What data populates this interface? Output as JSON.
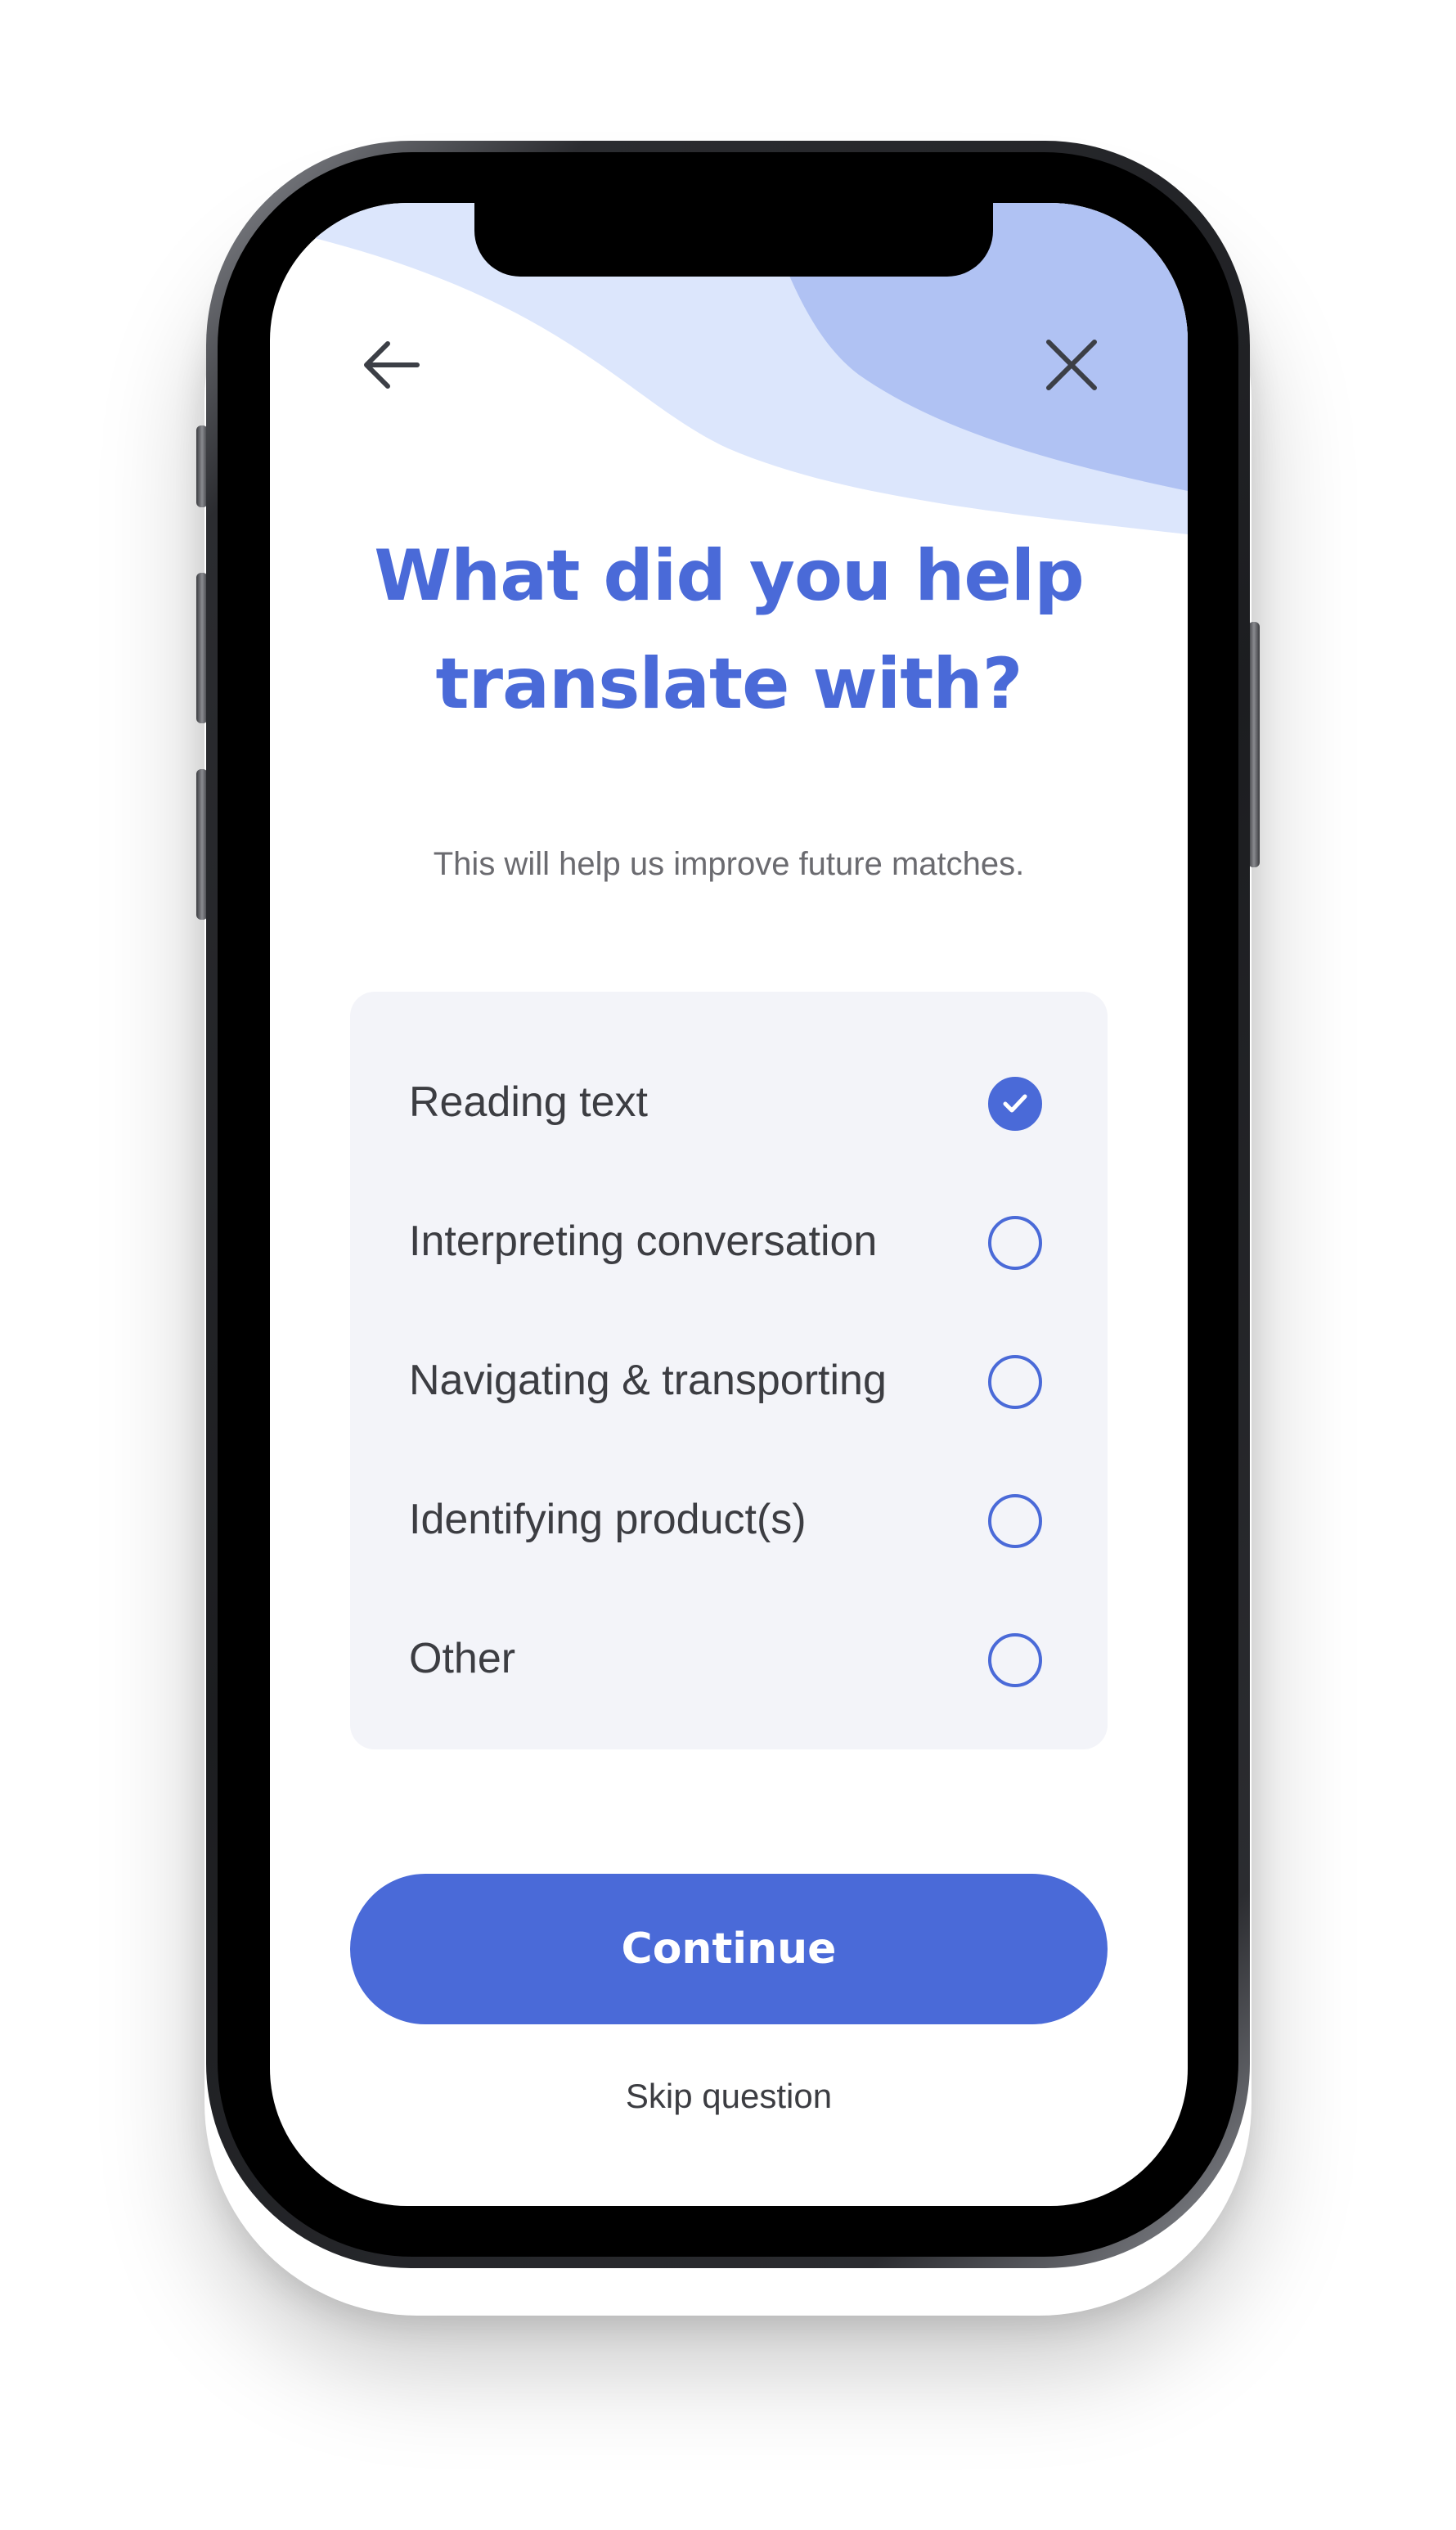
{
  "header": {
    "back_icon": "arrow-left-icon",
    "close_icon": "close-icon"
  },
  "content": {
    "title_line1": "What did you help",
    "title_line2": "translate with?",
    "subtitle": "This will help us improve future matches."
  },
  "options": [
    {
      "label": "Reading text",
      "selected": true
    },
    {
      "label": "Interpreting conversation",
      "selected": false
    },
    {
      "label": "Navigating & transporting",
      "selected": false
    },
    {
      "label": "Identifying product(s)",
      "selected": false
    },
    {
      "label": "Other",
      "selected": false
    }
  ],
  "actions": {
    "continue_label": "Continue",
    "skip_label": "Skip question"
  },
  "colors": {
    "accent": "#4a6ad8",
    "wave_light": "#dce6fc",
    "wave_dark": "#b0c2f3",
    "card_bg": "#f3f4f9"
  }
}
